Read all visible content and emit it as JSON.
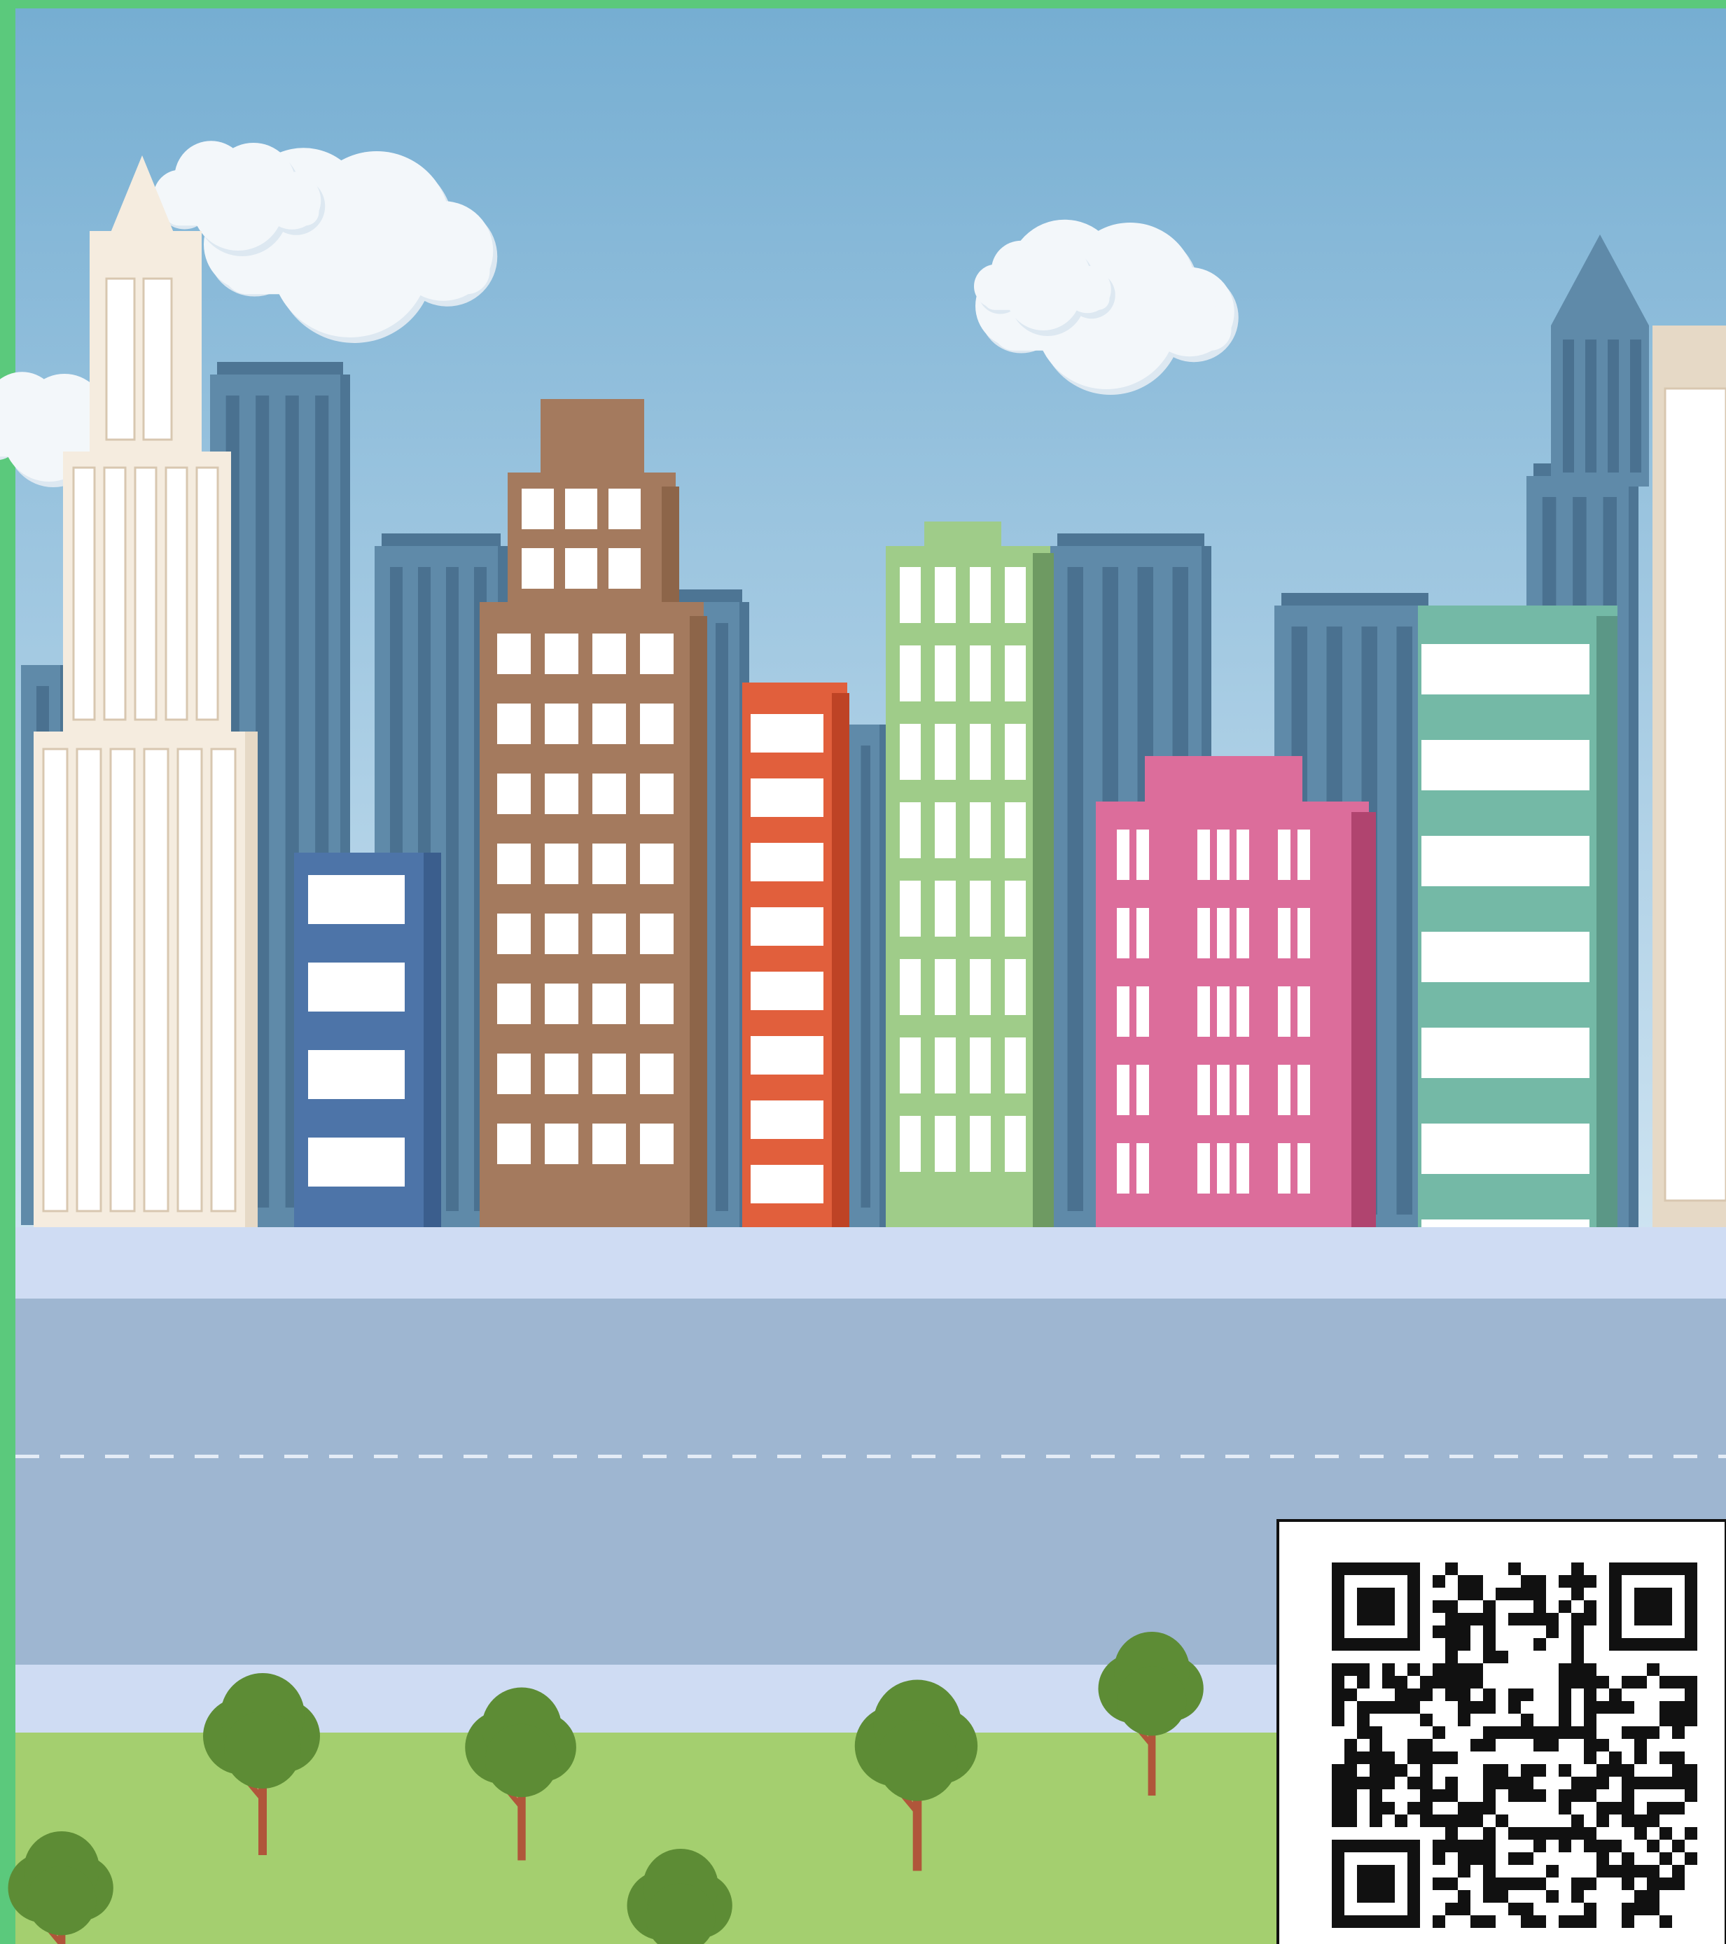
{
  "colors": {
    "frame_green": "#5bc97c",
    "sky_top": "#76aed2",
    "sky_bottom": "#cde3f1",
    "cloud": "#f3f7fa",
    "cloud_shade": "#dde8f1",
    "back_building": "#5f8aa9",
    "back_building_dark": "#4d7594",
    "back_window": "#4a7190",
    "cream": "#f5ecdf",
    "cream_side": "#e6d9c6",
    "cream_line": "#d8c7b0",
    "blue": "#4d74a8",
    "blue_side": "#3b5e8d",
    "brown": "#a47a5e",
    "brown_side": "#8d6549",
    "red": "#e15f3c",
    "red_side": "#be4325",
    "green": "#9fcc89",
    "green_side": "#6e9a62",
    "pink": "#dc6d9b",
    "pink_side": "#b0446f",
    "teal": "#74b9a6",
    "teal_side": "#5b9786",
    "window": "#ffffff",
    "sidewalk": "#cfdcf3",
    "road": "#9eb6d1",
    "road_dash": "#e4ecf6",
    "grass": "#a4cf6f",
    "tree": "#5d8c35",
    "trunk": "#b0563a",
    "qr_dark": "#111111",
    "qr_light": "#ffffff"
  },
  "qr_code": {
    "label": "qr-code",
    "modules": 29
  }
}
